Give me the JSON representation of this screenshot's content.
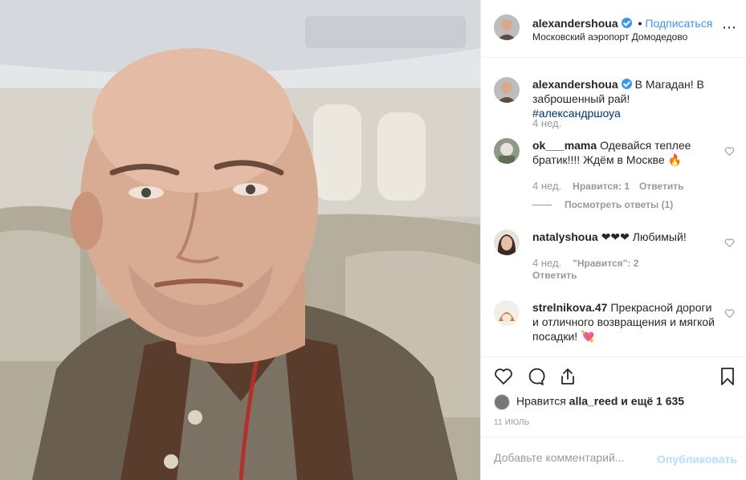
{
  "post": {
    "author": "alexandershoua",
    "follow_label": "Подписаться",
    "dot": "•",
    "location": "Московский аэропорт Домодедово",
    "more_icon": "⋯",
    "caption_text": "В Магадан! В заброшенный рай!",
    "caption_hashtag": "#александршоуа",
    "caption_age": "4 нед."
  },
  "comments": [
    {
      "user": "ok___mama",
      "text": "Одевайся теплее братик!!!! Ждём в Москве 🔥",
      "age": "4 нед.",
      "likes": "Нравится: 1",
      "reply": "Ответить",
      "view_replies": "Посмотреть ответы (1)"
    },
    {
      "user": "natalyshoua",
      "text": "❤❤❤ Любимый!",
      "age": "4 нед.",
      "likes": "\"Нравится\": 2",
      "reply": "Ответить"
    },
    {
      "user": "strelnikova.47",
      "text": "Прекрасной дороги и отличного возвращения и мягкой посадки! 💘"
    }
  ],
  "actions": {
    "like_icon": "heart-icon",
    "comment_icon": "comment-icon",
    "share_icon": "share-icon",
    "save_icon": "bookmark-icon"
  },
  "likes": {
    "prefix": "Нравится",
    "user": "alla_reed",
    "suffix": "и ещё 1 635"
  },
  "date": "11 ИЮЛЬ",
  "add_comment": {
    "placeholder": "Добавьте комментарий...",
    "post_label": "Опубликовать"
  },
  "colors": {
    "accent": "#3897f0",
    "post_disabled": "#b2dffc",
    "secondary_text": "#999999"
  }
}
